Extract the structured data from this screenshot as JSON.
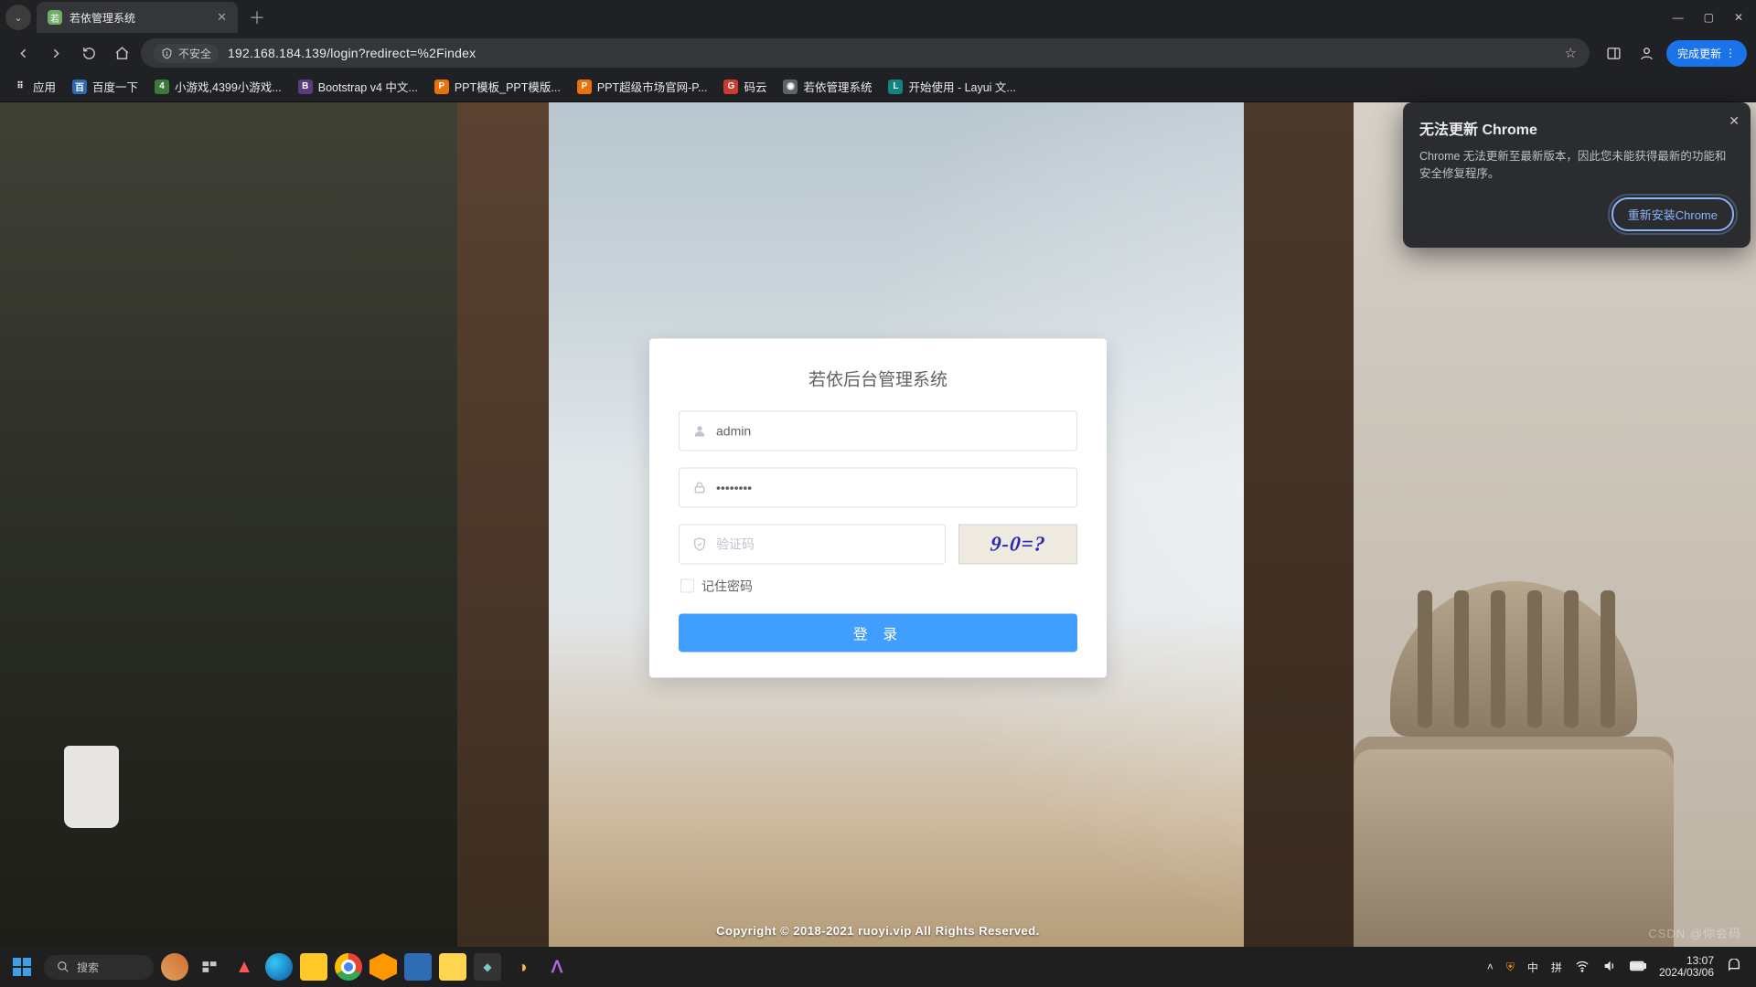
{
  "browser": {
    "tab_title": "若依管理系统",
    "security_label": "不安全",
    "url": "192.168.184.139/login?redirect=%2Findex",
    "update_pill": "完成更新",
    "bookmarks": [
      {
        "label": "应用",
        "cls": "c-apps",
        "glyph": "⠿"
      },
      {
        "label": "百度一下",
        "cls": "c-blue",
        "glyph": "百"
      },
      {
        "label": "小游戏,4399小游戏...",
        "cls": "c-green",
        "glyph": "4"
      },
      {
        "label": "Bootstrap v4 中文...",
        "cls": "c-purple",
        "glyph": "B"
      },
      {
        "label": "PPT模板_PPT模版...",
        "cls": "c-orange",
        "glyph": "P"
      },
      {
        "label": "PPT超级市场官网-P...",
        "cls": "c-orange",
        "glyph": "P"
      },
      {
        "label": "码云",
        "cls": "c-red",
        "glyph": "G"
      },
      {
        "label": "若依管理系统",
        "cls": "c-grey",
        "glyph": "◉"
      },
      {
        "label": "开始使用 - Layui 文...",
        "cls": "c-teal",
        "glyph": "L"
      }
    ]
  },
  "popup": {
    "title": "无法更新 Chrome",
    "body": "Chrome 无法更新至最新版本，因此您未能获得最新的功能和安全修复程序。",
    "button": "重新安装Chrome"
  },
  "login": {
    "title": "若依后台管理系统",
    "username_value": "admin",
    "password_value": "••••••••",
    "captcha_placeholder": "验证码",
    "captcha_text": "9-0=?",
    "remember_label": "记住密码",
    "submit_label": "登 录",
    "footer": "Copyright © 2018-2021 ruoyi.vip All Rights Reserved."
  },
  "taskbar": {
    "search_placeholder": "搜索",
    "ime_lang": "中",
    "ime_mode": "拼",
    "time": "13:07",
    "date": "2024/03/06"
  },
  "watermark": "CSDN @你会码"
}
